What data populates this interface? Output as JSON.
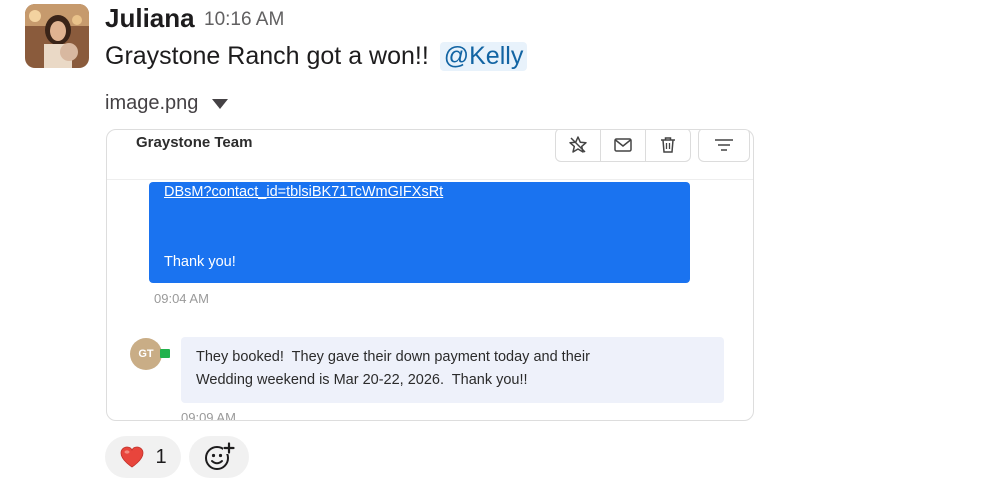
{
  "message": {
    "sender": "Juliana",
    "time": "10:16 AM",
    "text": "Graystone Ranch got a won!!",
    "mention": "@Kelly"
  },
  "attachment": {
    "filename": "image.png",
    "screenshot": {
      "header_title": "Graystone Team",
      "toolbar": {
        "icons": [
          "star-remove-icon",
          "mail-icon",
          "trash-icon",
          "filter-icon"
        ]
      },
      "outgoing": {
        "link_text": "DBsM?contact_id=tblsiBK71TcWmGIFXsRt",
        "thanks": "Thank you!",
        "time": "09:04 AM",
        "color": "#1a73f0"
      },
      "incoming": {
        "avatar_initials": "GT",
        "line1": "They booked!  They gave their down payment today and their",
        "line2": "Wedding weekend is Mar 20-22, 2026.  Thank you!!",
        "time": "09:09 AM"
      }
    }
  },
  "reactions": [
    {
      "emoji": "❤️",
      "count": "1"
    }
  ],
  "add_reaction_icon": "add-emoji-icon"
}
